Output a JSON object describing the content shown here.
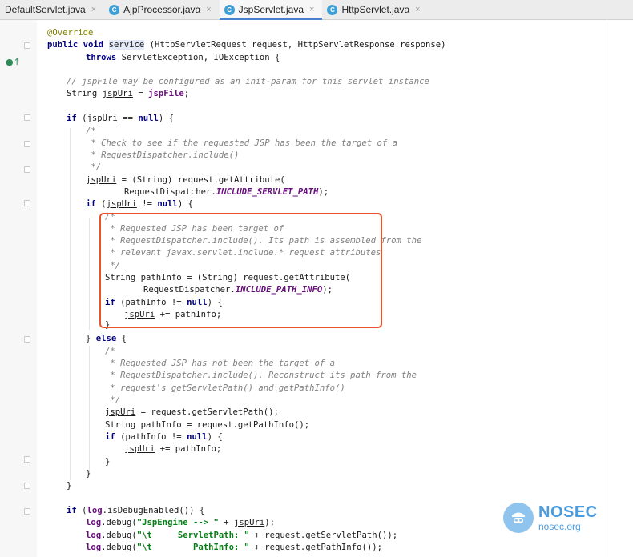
{
  "tabs": [
    {
      "label": "DefaultServlet.java",
      "active": false
    },
    {
      "label": "AjpProcessor.java",
      "active": false
    },
    {
      "label": "JspServlet.java",
      "active": true
    },
    {
      "label": "HttpServlet.java",
      "active": false
    }
  ],
  "class_icon_letter": "C",
  "close_glyph": "×",
  "code": {
    "l01": {
      "a": "@Override"
    },
    "l02": {
      "a": "public",
      "b": " ",
      "c": "void",
      "d": " ",
      "e": "service",
      "f": " (HttpServletRequest request, HttpServletResponse response)"
    },
    "l03": {
      "a": "throws",
      "b": " ServletException, IOException {"
    },
    "l04": {
      "a": "// jspFile may be configured as an init-param for this servlet instance"
    },
    "l05": {
      "a": "String ",
      "b": "jspUri",
      "c": " = ",
      "d": "jspFile",
      "e": ";"
    },
    "l06": {
      "a": "if",
      "b": " (",
      "c": "jspUri",
      "d": " == ",
      "e": "null",
      "f": ") {"
    },
    "l07": {
      "a": "/*"
    },
    "l08": {
      "a": " * Check to see if the requested JSP has been the target of a"
    },
    "l09": {
      "a": " * RequestDispatcher.include()"
    },
    "l10": {
      "a": " */"
    },
    "l11": {
      "a": "jspUri",
      "b": " = (String) request.getAttribute("
    },
    "l12": {
      "a": "RequestDispatcher.",
      "b": "INCLUDE_SERVLET_PATH",
      "c": ");"
    },
    "l13": {
      "a": "if",
      "b": " (",
      "c": "jspUri",
      "d": " != ",
      "e": "null",
      "f": ") {"
    },
    "l14": {
      "a": "/*"
    },
    "l15": {
      "a": " * Requested JSP has been target of"
    },
    "l16": {
      "a": " * RequestDispatcher.include(). Its path is assembled from the"
    },
    "l17": {
      "a": " * relevant javax.servlet.include.* request attributes"
    },
    "l18": {
      "a": " */"
    },
    "l19": {
      "a": "String pathInfo = (String) request.getAttribute("
    },
    "l20": {
      "a": "RequestDispatcher.",
      "b": "INCLUDE_PATH_INFO",
      "c": ");"
    },
    "l21": {
      "a": "if",
      "b": " (pathInfo != ",
      "c": "null",
      "d": ") {"
    },
    "l22": {
      "a": "jspUri",
      "b": " += pathInfo;"
    },
    "l23": {
      "a": "}"
    },
    "l24": {
      "a": "} ",
      "b": "else",
      "c": " {"
    },
    "l25": {
      "a": "/*"
    },
    "l26": {
      "a": " * Requested JSP has not been the target of a"
    },
    "l27": {
      "a": " * RequestDispatcher.include(). Reconstruct its path from the"
    },
    "l28": {
      "a": " * request's getServletPath() and getPathInfo()"
    },
    "l29": {
      "a": " */"
    },
    "l30": {
      "a": "jspUri",
      "b": " = request.getServletPath();"
    },
    "l31": {
      "a": "String pathInfo = request.getPathInfo();"
    },
    "l32": {
      "a": "if",
      "b": " (pathInfo != ",
      "c": "null",
      "d": ") {"
    },
    "l33": {
      "a": "jspUri",
      "b": " += pathInfo;"
    },
    "l34": {
      "a": "}"
    },
    "l35": {
      "a": "}"
    },
    "l36": {
      "a": "}"
    },
    "l37": {
      "a": "if",
      "b": " (",
      "c": "log",
      "d": ".isDebugEnabled()) {"
    },
    "l38": {
      "a": "log",
      "b": ".debug(",
      "c": "\"JspEngine --> \"",
      "d": " + ",
      "e": "jspUri",
      "f": ");"
    },
    "l39": {
      "a": "log",
      "b": ".debug(",
      "c": "\"\\t     ServletPath: \"",
      "d": " + request.getServletPath());"
    },
    "l40": {
      "a": "log",
      "b": ".debug(",
      "c": "\"\\t        PathInfo: \"",
      "d": " + request.getPathInfo());"
    }
  },
  "watermark": {
    "name": "NOSEC",
    "domain": "nosec.org"
  },
  "colors": {
    "highlight_box": "#e8532c",
    "active_tab_underline": "#4a7fd4",
    "watermark": "#4a9ce0"
  }
}
